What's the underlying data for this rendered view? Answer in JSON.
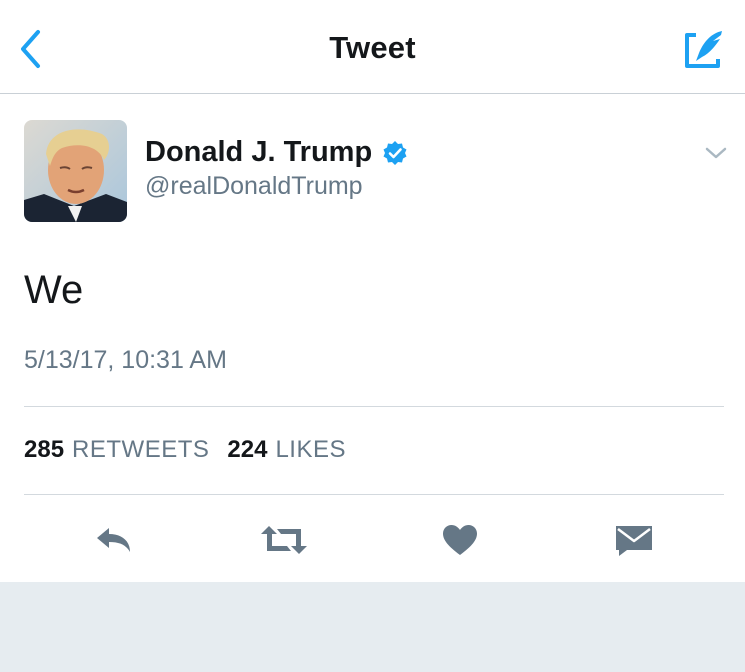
{
  "header": {
    "title": "Tweet",
    "back_icon": "chevron-left-icon",
    "compose_icon": "compose-tweet-icon",
    "accent_color": "#1da1f2"
  },
  "author": {
    "name": "Donald J. Trump",
    "handle": "@realDonaldTrump",
    "verified": true,
    "avatar_icon": "user-avatar"
  },
  "tweet": {
    "text": "We",
    "timestamp": "5/13/17, 10:31 AM"
  },
  "stats": {
    "retweets_count": "285",
    "retweets_label": "RETWEETS",
    "likes_count": "224",
    "likes_label": "LIKES"
  },
  "actions": {
    "reply_icon": "reply-icon",
    "retweet_icon": "retweet-icon",
    "like_icon": "heart-icon",
    "dm_icon": "envelope-icon",
    "icon_color": "#657786"
  }
}
